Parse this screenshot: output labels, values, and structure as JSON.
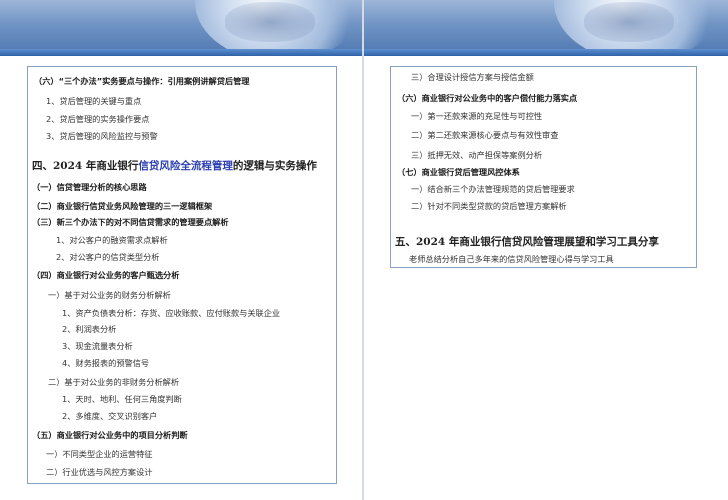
{
  "left": {
    "lines": [
      {
        "text": "（六）“三个办法”实务要点与操作：引用案例讲解贷后管理"
      },
      {
        "text": "1、贷后管理的关键与重点"
      },
      {
        "text": "2、贷后管理的实务操作要点"
      },
      {
        "text": "3、贷后管理的风险监控与预警"
      },
      {
        "prefix": "四、2024 年商业银行",
        "highlight": "信贷风险全流程管理",
        "suffix": "的逻辑与实务操作"
      },
      {
        "text": "（一）信贷管理分析的核心思路"
      },
      {
        "text": "（二）商业银行信贷业务风险管理的三一逻辑框架"
      },
      {
        "text": "（三）新三个办法下的对不同信贷需求的管理要点解析"
      },
      {
        "text": "1、对公客户的融资需求点解析"
      },
      {
        "text": "2、对公客户的信贷类型分析"
      },
      {
        "text": "（四）商业银行对公业务的客户甄选分析"
      },
      {
        "text": "一）基于对公业务的财务分析解析"
      },
      {
        "text": "1、资产负债表分析：存货、应收账款、应付账款与关联企业"
      },
      {
        "text": "2、利润表分析"
      },
      {
        "text": "3、现金流量表分析"
      },
      {
        "text": "4、财务报表的预警信号"
      },
      {
        "text": "二）基于对公业务的非财务分析解析"
      },
      {
        "text": "1、天时、地利、任何三角度判断"
      },
      {
        "text": "2、多维度、交叉识别客户"
      },
      {
        "text": "（五）商业银行对公业务中的项目分析判断"
      },
      {
        "text": "一）不同类型企业的运营特征"
      },
      {
        "text": "二）行业优选与风控方案设计"
      }
    ]
  },
  "right": {
    "lines": [
      {
        "text": "三）合理设计授信方案与授信金额"
      },
      {
        "text": "（六）商业银行对公业务中的客户偿付能力落实点"
      },
      {
        "text": "一）第一还款来源的充足性与可控性"
      },
      {
        "text": "二）第二还款来源核心要点与有效性审查"
      },
      {
        "text": "三）抵押无效、动产担保等案例分析"
      },
      {
        "text": "（七）商业银行贷后管理风控体系"
      },
      {
        "text": "一）结合新三个办法管理规范的贷后管理要求"
      },
      {
        "text": "二）针对不同类型贷款的贷后管理方案解析"
      },
      {
        "text": "五、2024 年商业银行信贷风险管理展望和学习工具分享"
      },
      {
        "text": "老师总结分析自己多年来的信贷风险管理心得与学习工具"
      }
    ]
  }
}
